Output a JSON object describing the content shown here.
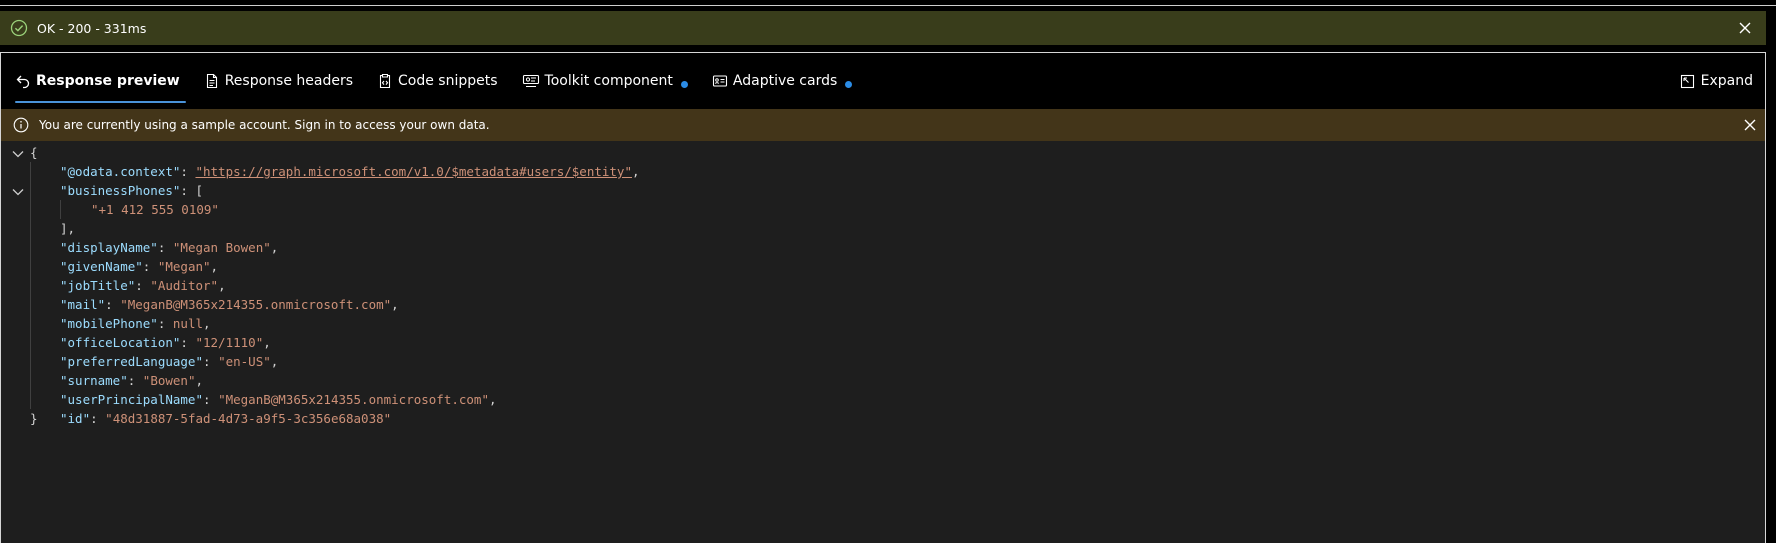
{
  "status": {
    "text": "OK - 200 - 331ms",
    "color": "#393d1b"
  },
  "tabs": [
    {
      "label": "Response preview",
      "icon": "undo-arrow-icon",
      "active": true
    },
    {
      "label": "Response headers",
      "icon": "document-icon"
    },
    {
      "label": "Code snippets",
      "icon": "clipboard-code-icon"
    },
    {
      "label": "Toolkit component",
      "icon": "toolkit-icon",
      "dot": true
    },
    {
      "label": "Adaptive cards",
      "icon": "card-icon",
      "dot": true
    }
  ],
  "expand": {
    "label": "Expand",
    "icon": "expand-icon"
  },
  "message": {
    "text": "You are currently using a sample account. Sign in to access your own data.",
    "color": "#433519"
  },
  "json": {
    "open_brace": "{",
    "close_brace": "}",
    "context_key": "\"@odata.context\"",
    "context_value": "\"https://graph.microsoft.com/v1.0/$metadata#users/$entity\"",
    "phones_key": "\"businessPhones\"",
    "phones_open": "[",
    "phones_item": "\"+1 412 555 0109\"",
    "phones_close": "],",
    "entries": [
      {
        "key": "\"displayName\"",
        "value": "\"Megan Bowen\"",
        "sep": ","
      },
      {
        "key": "\"givenName\"",
        "value": "\"Megan\"",
        "sep": ","
      },
      {
        "key": "\"jobTitle\"",
        "value": "\"Auditor\"",
        "sep": ","
      },
      {
        "key": "\"mail\"",
        "value": "\"MeganB@M365x214355.onmicrosoft.com\"",
        "sep": ","
      },
      {
        "key": "\"mobilePhone\"",
        "value": "null",
        "sep": ","
      },
      {
        "key": "\"officeLocation\"",
        "value": "\"12/1110\"",
        "sep": ","
      },
      {
        "key": "\"preferredLanguage\"",
        "value": "\"en-US\"",
        "sep": ","
      },
      {
        "key": "\"surname\"",
        "value": "\"Bowen\"",
        "sep": ","
      },
      {
        "key": "\"userPrincipalName\"",
        "value": "\"MeganB@M365x214355.onmicrosoft.com\"",
        "sep": ","
      },
      {
        "key": "\"id\"",
        "value": "\"48d31887-5fad-4d73-a9f5-3c356e68a038\"",
        "sep": ""
      }
    ]
  },
  "colors": {
    "key": "#9cdcfe",
    "string": "#ce9178",
    "accent": "#4a93d9",
    "dot": "#2b8ce6"
  }
}
